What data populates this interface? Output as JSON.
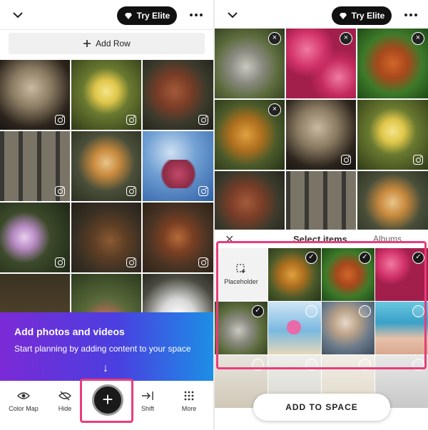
{
  "left": {
    "topbar": {
      "elite_label": "Try Elite"
    },
    "add_row_label": "Add Row",
    "promo": {
      "title": "Add photos and videos",
      "subtitle": "Start planning by adding content to your space",
      "arrow": "↓"
    },
    "toolbar": {
      "color_map": "Color Map",
      "hide": "Hide",
      "shift": "Shift",
      "more": "More",
      "add": "+"
    }
  },
  "right": {
    "topbar": {
      "elite_label": "Try Elite"
    },
    "sheet": {
      "close": "✕",
      "title": "Select items",
      "albums": "Albums"
    },
    "placeholder_label": "Placeholder",
    "add_to_space": "ADD TO SPACE"
  },
  "icons": {
    "close": "×",
    "check": "✓"
  },
  "colors": {
    "accent": "#e83d7a",
    "dark": "#111111",
    "promo_start": "#7b2ad6",
    "promo_end": "#1c8fe6"
  }
}
